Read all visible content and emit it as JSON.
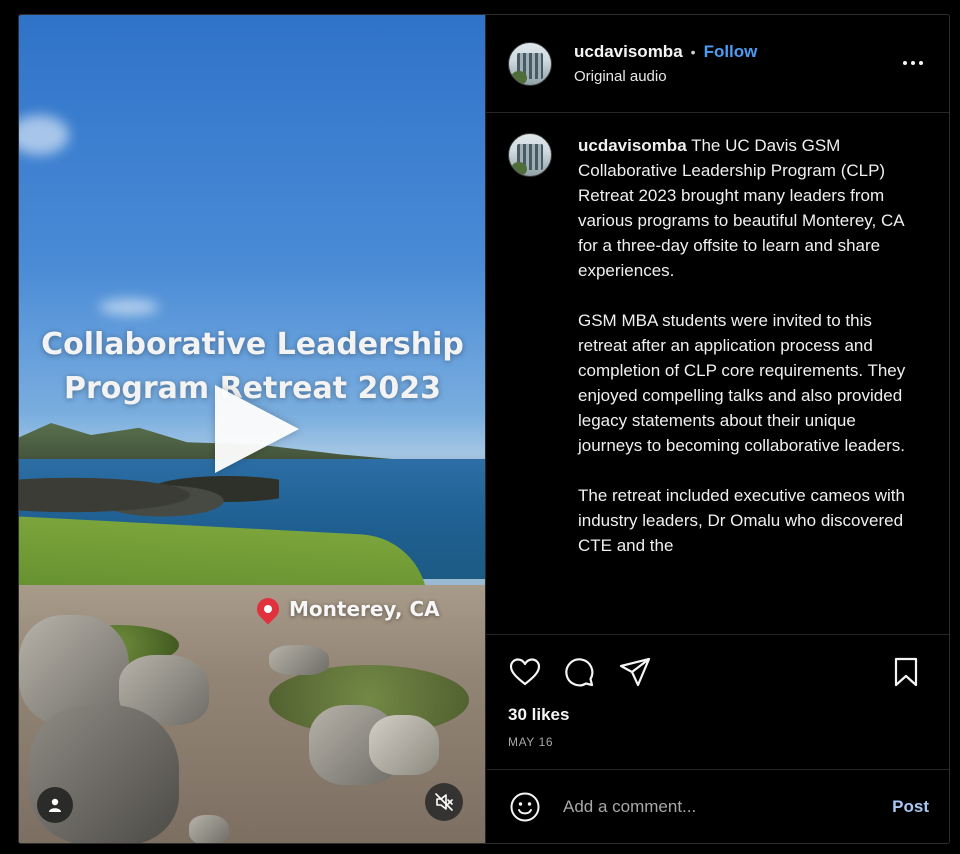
{
  "video": {
    "overlay_title": "Collaborative Leadership\nProgram Retreat 2023",
    "location": "Monterey, CA"
  },
  "header": {
    "username": "ucdavisomba",
    "separator": "•",
    "follow_label": "Follow",
    "audio": "Original audio"
  },
  "caption": {
    "username": "ucdavisomba",
    "paragraphs": [
      "The UC Davis GSM Collaborative Leadership Program (CLP) Retreat 2023 brought many leaders from various programs to beautiful Monterey, CA for a three-day offsite to learn and share experiences.",
      "GSM MBA students were invited to this retreat after an application process and completion of CLP core requirements. They enjoyed compelling talks and also provided legacy statements about their unique journeys to becoming collaborative leaders.",
      "The retreat included executive cameos with industry leaders, Dr Omalu who discovered CTE and the"
    ]
  },
  "engagement": {
    "likes": "30 likes",
    "date": "MAY 16"
  },
  "comment": {
    "placeholder": "Add a comment...",
    "post_label": "Post"
  },
  "icons": {
    "play": "play-icon",
    "location": "pin-icon",
    "user_tag": "user-icon",
    "mute": "mute-icon",
    "more": "more-icon",
    "like": "heart-icon",
    "comment": "comment-icon",
    "share": "share-icon",
    "save": "bookmark-icon",
    "emoji": "emoji-icon"
  },
  "colors": {
    "accent": "#4c9cf2",
    "post": "#a6c8f3",
    "pin": "#e0313d",
    "background": "#000000"
  }
}
